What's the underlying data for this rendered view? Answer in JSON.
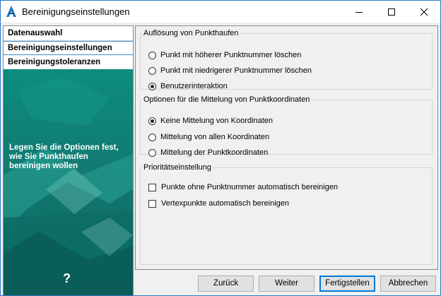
{
  "window": {
    "title": "Bereinigungseinstellungen",
    "icon": "autodesk-a-icon",
    "accent_color": "#2b79c6"
  },
  "nav": {
    "items": [
      {
        "label": "Datenauswahl"
      },
      {
        "label": "Bereinigungseinstellungen",
        "selected": true
      },
      {
        "label": "Bereinigungstoleranzen"
      }
    ],
    "hint": "Legen Sie die Optionen fest,\nwie Sie Punkthaufen\nbereinigen wollen",
    "help": "?"
  },
  "groups": {
    "resolution": {
      "title": "Auflösung von Punkthaufen",
      "options": [
        {
          "label": "Punkt mit höherer Punktnummer löschen",
          "checked": false
        },
        {
          "label": "Punkt mit niedrigerer Punktnummer löschen",
          "checked": false
        },
        {
          "label": "Benutzerinteraktion",
          "checked": true
        }
      ]
    },
    "averaging": {
      "title": "Optionen für die Mittelung von Punktkoordinaten",
      "options": [
        {
          "label": "Keine Mittelung von Koordinaten",
          "checked": true
        },
        {
          "label": "Mittelung von allen Koordinaten",
          "checked": false
        },
        {
          "label": "Mittelung der Punktkoordinaten",
          "checked": false
        }
      ]
    },
    "priority": {
      "title": "Prioritätseinstellung",
      "options": [
        {
          "label": "Punkte ohne Punktnummer automatisch bereinigen",
          "checked": false
        },
        {
          "label": "Vertexpunkte automatisch bereinigen",
          "checked": false
        }
      ]
    }
  },
  "buttons": {
    "back": "Zurück",
    "next": "Weiter",
    "finish": "Fertigstellen",
    "cancel": "Abbrechen"
  }
}
